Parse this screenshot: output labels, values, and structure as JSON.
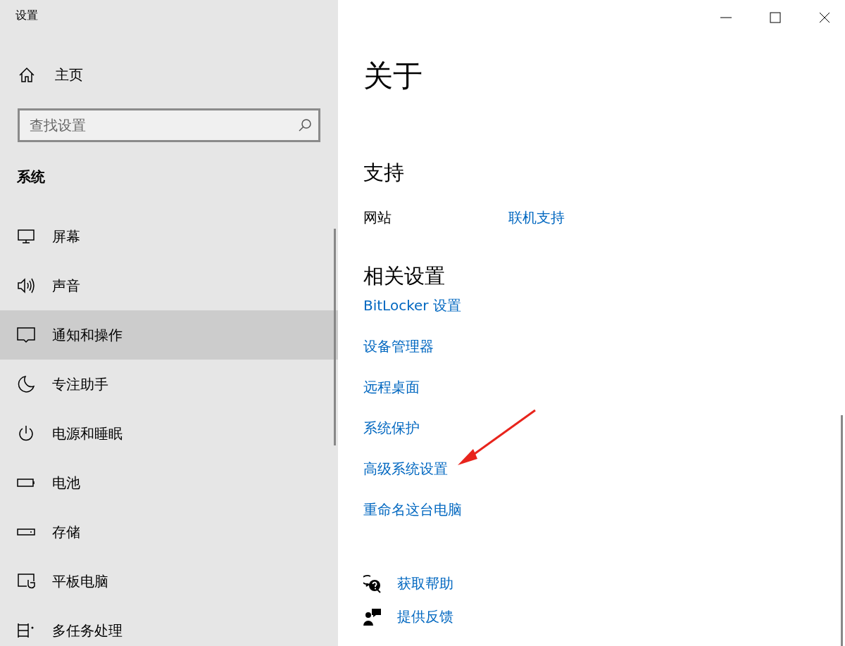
{
  "window": {
    "title": "设置"
  },
  "sidebar": {
    "home": {
      "label": "主页"
    },
    "search": {
      "placeholder": "查找设置"
    },
    "section": "系统",
    "items": [
      {
        "label": "屏幕",
        "kind": "display",
        "selected": false
      },
      {
        "label": "声音",
        "kind": "sound",
        "selected": false
      },
      {
        "label": "通知和操作",
        "kind": "notification",
        "selected": true
      },
      {
        "label": "专注助手",
        "kind": "focus",
        "selected": false
      },
      {
        "label": "电源和睡眠",
        "kind": "power",
        "selected": false
      },
      {
        "label": "电池",
        "kind": "battery",
        "selected": false
      },
      {
        "label": "存储",
        "kind": "storage",
        "selected": false
      },
      {
        "label": "平板电脑",
        "kind": "tablet",
        "selected": false
      },
      {
        "label": "多任务处理",
        "kind": "multitask",
        "selected": false
      }
    ]
  },
  "main": {
    "title": "关于",
    "support": {
      "heading": "支持",
      "rows": [
        {
          "label": "网站",
          "link": "联机支持"
        }
      ]
    },
    "related": {
      "heading": "相关设置",
      "links": [
        "BitLocker 设置",
        "设备管理器",
        "远程桌面",
        "系统保护",
        "高级系统设置",
        "重命名这台电脑"
      ]
    },
    "help_links": [
      {
        "label": "获取帮助",
        "kind": "help"
      },
      {
        "label": "提供反馈",
        "kind": "feedback"
      }
    ]
  }
}
